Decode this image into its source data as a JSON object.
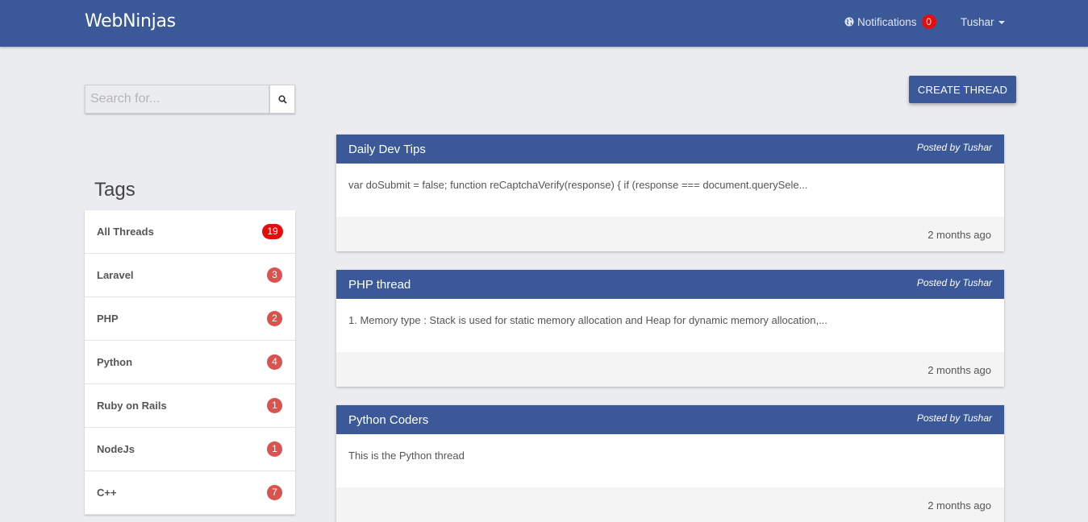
{
  "brand": "WebNinjas",
  "nav": {
    "notifications_label": "Notifications",
    "notifications_count": "0",
    "user": "Tushar"
  },
  "search": {
    "placeholder": "Search for...",
    "icon": "search-icon"
  },
  "create_thread_label": "CREATE THREAD",
  "tags": {
    "title": "Tags",
    "items": [
      {
        "label": "All Threads",
        "count": "19"
      },
      {
        "label": "Laravel",
        "count": "3"
      },
      {
        "label": "PHP",
        "count": "2"
      },
      {
        "label": "Python",
        "count": "4"
      },
      {
        "label": "Ruby on Rails",
        "count": "1"
      },
      {
        "label": "NodeJs",
        "count": "1"
      },
      {
        "label": "C++",
        "count": "7"
      }
    ]
  },
  "threads": [
    {
      "title": "Daily Dev Tips",
      "posted_by": "Posted by Tushar",
      "excerpt": "var doSubmit = false; function reCaptchaVerify(response) { if (response === document.querySele...",
      "time": "2 months ago"
    },
    {
      "title": "PHP thread",
      "posted_by": "Posted by Tushar",
      "excerpt": "1. Memory type : Stack is used for static memory allocation and Heap for dynamic memory allocation,...",
      "time": "2 months ago"
    },
    {
      "title": "Python Coders",
      "posted_by": "Posted by Tushar",
      "excerpt": "This is the Python thread",
      "time": "2 months ago"
    }
  ],
  "colors": {
    "primary": "#3b5998",
    "badge_red": "#d9534f",
    "badge_bright_red": "#e30d0d",
    "background": "#ebecf0"
  }
}
